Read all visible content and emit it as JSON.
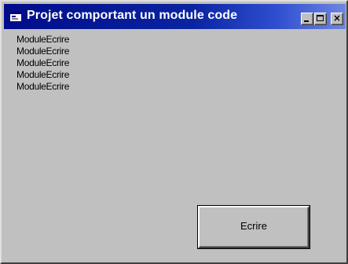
{
  "window": {
    "title": "Projet comportant un module code",
    "icon": "form-icon",
    "controls": {
      "minimize": "minimize-icon",
      "maximize": "maximize-icon",
      "close": "close-icon"
    }
  },
  "output": {
    "lines": [
      "ModuleEcrire",
      "ModuleEcrire",
      "ModuleEcrire",
      "ModuleEcrire",
      "ModuleEcrire"
    ]
  },
  "button": {
    "label": "Ecrire"
  },
  "colors": {
    "title_bar_start": "#000c8a",
    "title_bar_end": "#6f86e0",
    "face": "#c0c0c0",
    "title_text": "#ffffff"
  }
}
